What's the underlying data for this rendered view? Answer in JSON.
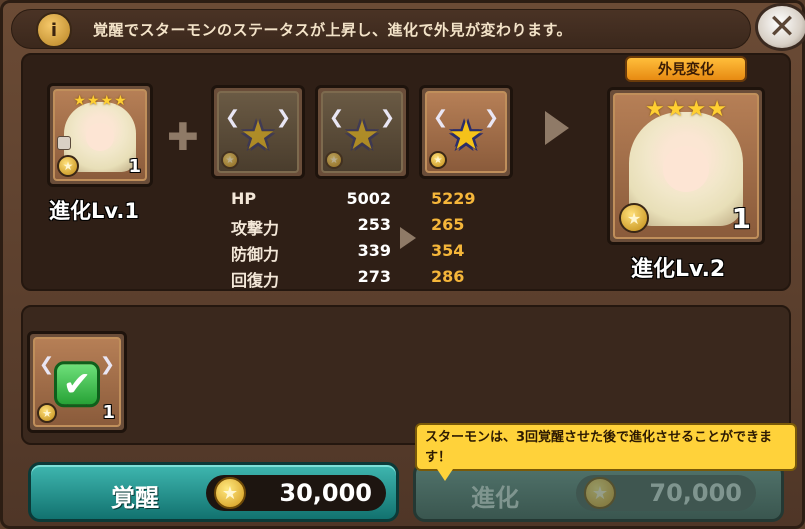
{
  "header": {
    "info_icon": "i",
    "description": "覚醒でスターモンのステータスが上昇し、進化で外見が変わります。",
    "close_icon": "✕"
  },
  "current_monster": {
    "level_label": "進化Lv.1",
    "count": "1",
    "stars": 4
  },
  "material_slots": [
    {
      "state": "dim"
    },
    {
      "state": "dim"
    },
    {
      "state": "bright"
    }
  ],
  "stats": [
    {
      "label": "HP",
      "current": "5002",
      "next": "5229"
    },
    {
      "label": "攻撃力",
      "current": "253",
      "next": "265"
    },
    {
      "label": "防御力",
      "current": "339",
      "next": "354"
    },
    {
      "label": "回復力",
      "current": "273",
      "next": "286"
    }
  ],
  "next_monster": {
    "badge": "外見変化",
    "level_label": "進化Lv.2",
    "count": "1",
    "stars": 4
  },
  "inventory": {
    "item_count": "1"
  },
  "tooltip": {
    "text": "スターモンは、3回覚醒させた後で進化させることができます！"
  },
  "actions": {
    "awaken_label": "覚醒",
    "awaken_cost": "30,000",
    "evolve_label": "進化",
    "evolve_cost": "70,000"
  },
  "colors": {
    "awaken_button": "#1f8a86",
    "evolve_button_disabled": "#4a655f",
    "stat_new_value": "#f5b63a",
    "tooltip_bg": "#ffd23a"
  }
}
